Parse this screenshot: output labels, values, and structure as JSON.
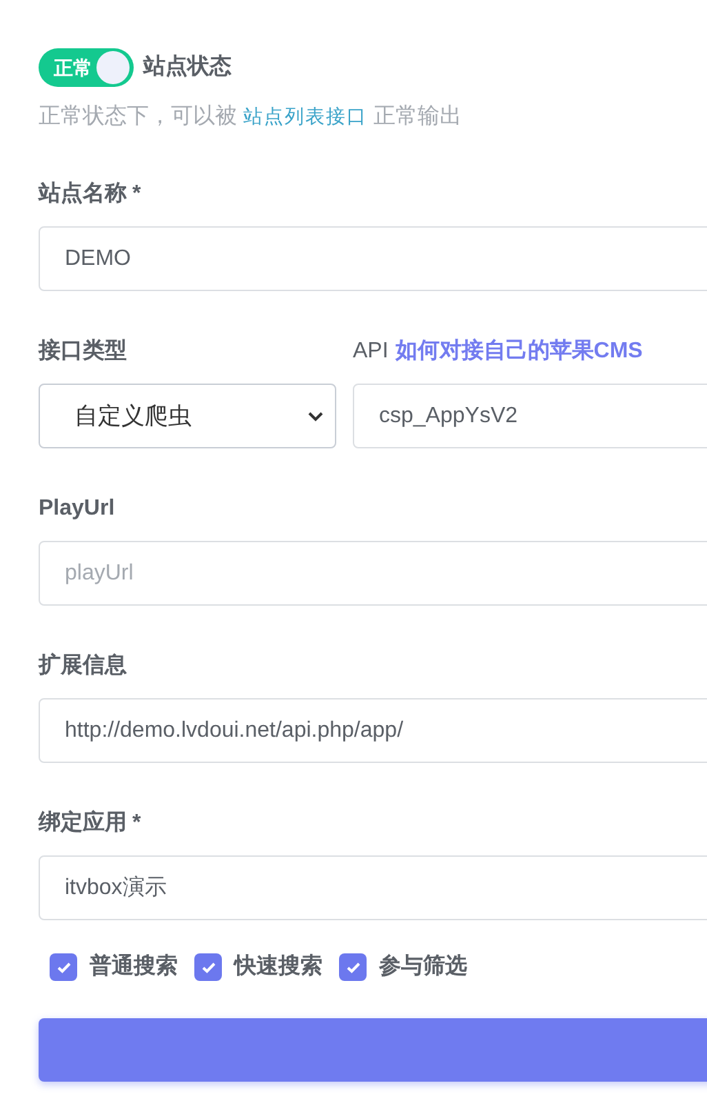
{
  "status": {
    "on": true,
    "toggle_label": "正常",
    "title": "站点状态",
    "hint_before": "正常状态下，可以被",
    "hint_link": "站点列表接口",
    "hint_after": "正常输出"
  },
  "site_name": {
    "label": "站点名称",
    "required_mark": "*",
    "value": "DEMO"
  },
  "api_type": {
    "label": "接口类型",
    "value": "自定义爬虫"
  },
  "api": {
    "label": "API",
    "link": "如何对接自己的苹果CMS",
    "value": "csp_AppYsV2"
  },
  "play_url": {
    "label": "PlayUrl",
    "placeholder": "playUrl"
  },
  "extend": {
    "label": "扩展信息",
    "value": "http://demo.lvdoui.net/api.php/app/"
  },
  "bind_app": {
    "label": "绑定应用",
    "required_mark": "*",
    "value": "itvbox演示"
  },
  "options": [
    {
      "label": "普通搜索",
      "checked": true
    },
    {
      "label": "快速搜索",
      "checked": true
    },
    {
      "label": "参与筛选",
      "checked": true
    }
  ]
}
